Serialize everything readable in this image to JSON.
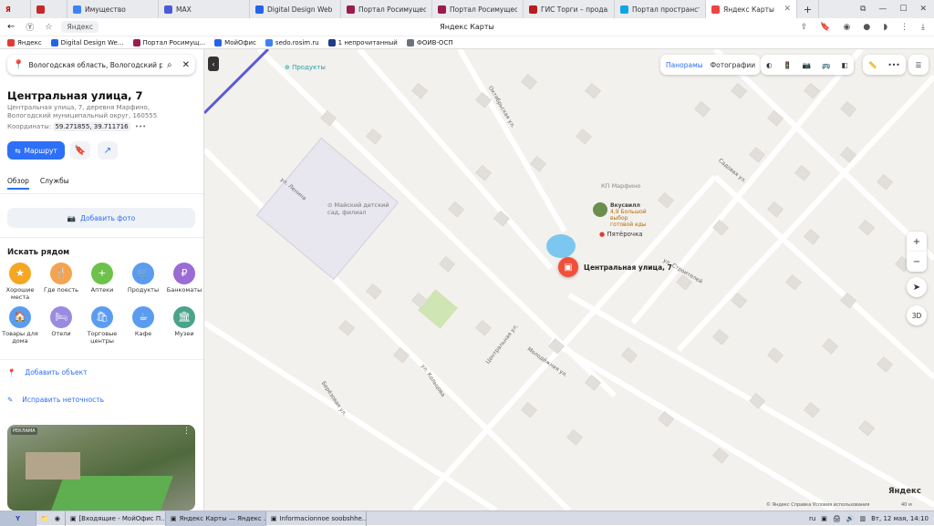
{
  "browser": {
    "tabs": [
      {
        "label": "",
        "color": "#c62828"
      },
      {
        "label": "Имущество",
        "color": "#3b82f6"
      },
      {
        "label": "MAX",
        "color": "#4b5bd6"
      },
      {
        "label": "Digital Design Web Clie...",
        "color": "#2563eb"
      },
      {
        "label": "Портал Росимущества",
        "color": "#9b1b4d"
      },
      {
        "label": "Портал Росимущества",
        "color": "#9b1b4d"
      },
      {
        "label": "ГИС Торги – продажи г...",
        "color": "#b91c1c"
      },
      {
        "label": "Портал пространствен...",
        "color": "#0ea5e9"
      },
      {
        "label": "Яндекс Карты",
        "color": "#ef4444"
      }
    ],
    "page_title": "Яндекс Карты",
    "url": "Яндекс",
    "bookmarks": [
      "Яндекс",
      "Digital Design We...",
      "Портал Росимущ...",
      "МойОфис",
      "sedo.rosim.ru",
      "1 непрочитанный",
      "ФОИВ-ОСП"
    ]
  },
  "panel": {
    "search_value": "Вологодская область, Вологодский р",
    "title": "Центральная улица, 7",
    "address": "Центральная улица, 7, деревня Марфино, Вологодский муниципальный округ, 160555",
    "coords_label": "Координаты:",
    "coords_value": "59.271855, 39.711716",
    "route_label": "Маршрут",
    "tab_overview": "Обзор",
    "tab_services": "Службы",
    "add_photo": "Добавить фото",
    "nearby_title": "Искать рядом",
    "categories": [
      {
        "label": "Хорошие места",
        "color": "#f5a623",
        "icon": "★"
      },
      {
        "label": "Где поесть",
        "color": "#f4a34f",
        "icon": "🍴"
      },
      {
        "label": "Аптеки",
        "color": "#6cc24a",
        "icon": "+"
      },
      {
        "label": "Продукты",
        "color": "#5b9cf0",
        "icon": "🛒"
      },
      {
        "label": "Банкоматы",
        "color": "#9b6bd6",
        "icon": "₽"
      },
      {
        "label": "Товары для дома",
        "color": "#5b9cf0",
        "icon": "🏠"
      },
      {
        "label": "Отели",
        "color": "#9b8be0",
        "icon": "🛏"
      },
      {
        "label": "Торговые центры",
        "color": "#5b9cf0",
        "icon": "🛍"
      },
      {
        "label": "Кафе",
        "color": "#5b9cf0",
        "icon": "☕"
      },
      {
        "label": "Музеи",
        "color": "#4aa38a",
        "icon": "🏛"
      }
    ],
    "add_object": "Добавить объект",
    "fix_error": "Исправить неточность",
    "ad_label": "РЕКЛАМА"
  },
  "map": {
    "panoramas": "Панорамы",
    "photos": "Фотографии",
    "pin_label": "Центральная улица, 7",
    "poi_products": "Продукты",
    "poi_kindergarten": "Майский детский сад, филиал",
    "poi_pyaterochka": "Пятёрочка",
    "poi_kp": "КП Марфино",
    "poi_ad_name": "Вкусвилл",
    "poi_ad_text": "4,9 Большой выбор готовой еды",
    "streets": [
      "Центральная ул.",
      "Молодёжная ул.",
      "ул. Кольцова",
      "ул. Строителей",
      "Садовая ул.",
      "Октябрьская ул.",
      "ул. Ленина",
      "Берёзовая ул."
    ],
    "zoom_in": "+",
    "zoom_out": "−",
    "btn_3d": "3D",
    "brand": "Яндекс",
    "footer": "© Яндекс  Справка  Условия использования",
    "scale": "40 м"
  },
  "taskbar": {
    "items": [
      "[Входящие - МойОфис П...",
      "Яндекс Карты — Яндекс ...",
      "Informacionnoe soobshhe..."
    ],
    "lang": "ru",
    "clock": "Вт, 12 мая, 14:10"
  }
}
